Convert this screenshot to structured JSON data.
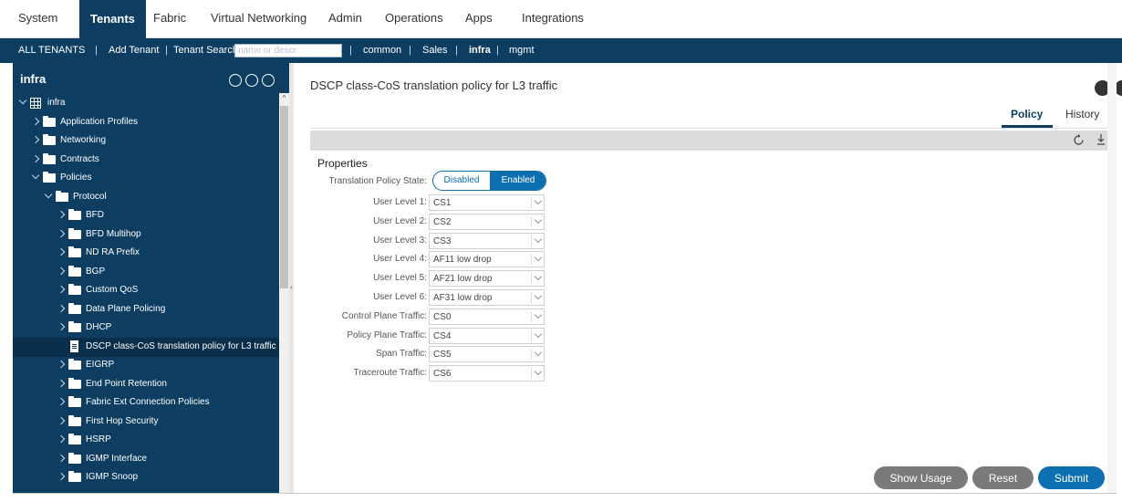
{
  "topnav": {
    "items": [
      "System",
      "Tenants",
      "Fabric",
      "Virtual Networking",
      "Admin",
      "Operations",
      "Apps",
      "Integrations"
    ],
    "active": "Tenants"
  },
  "tenantbar": {
    "all_tenants": "ALL TENANTS",
    "add_tenant": "Add Tenant",
    "search_label": "Tenant Search:",
    "search_placeholder": "name or descr",
    "tenants": [
      "common",
      "Sales",
      "infra",
      "mgmt"
    ],
    "separator": "|"
  },
  "sidebar": {
    "title": "infra",
    "tree": [
      {
        "label": "infra",
        "icon": "tenant-grid-icon",
        "chevron": "down"
      },
      {
        "label": "Application Profiles",
        "icon": "folder-icon",
        "chevron": "right"
      },
      {
        "label": "Networking",
        "icon": "folder-icon",
        "chevron": "right"
      },
      {
        "label": "Contracts",
        "icon": "folder-icon",
        "chevron": "right"
      },
      {
        "label": "Policies",
        "icon": "folder-icon",
        "chevron": "down"
      },
      {
        "label": "Protocol",
        "icon": "folder-icon",
        "chevron": "down"
      },
      {
        "label": "BFD",
        "icon": "folder-icon",
        "chevron": "right"
      },
      {
        "label": "BFD Multihop",
        "icon": "folder-icon",
        "chevron": "right"
      },
      {
        "label": "ND RA Prefix",
        "icon": "folder-icon",
        "chevron": "right"
      },
      {
        "label": "BGP",
        "icon": "folder-icon",
        "chevron": "right"
      },
      {
        "label": "Custom QoS",
        "icon": "folder-icon",
        "chevron": "right"
      },
      {
        "label": "Data Plane Policing",
        "icon": "folder-icon",
        "chevron": "right"
      },
      {
        "label": "DHCP",
        "icon": "folder-icon",
        "chevron": "right"
      },
      {
        "label": "DSCP class-CoS translation policy for L3 traffic",
        "icon": "document-icon",
        "chevron": "none",
        "selected": true
      },
      {
        "label": "EIGRP",
        "icon": "folder-icon",
        "chevron": "right"
      },
      {
        "label": "End Point Retention",
        "icon": "folder-icon",
        "chevron": "right"
      },
      {
        "label": "Fabric Ext Connection Policies",
        "icon": "folder-icon",
        "chevron": "right"
      },
      {
        "label": "First Hop Security",
        "icon": "folder-icon",
        "chevron": "right"
      },
      {
        "label": "HSRP",
        "icon": "folder-icon",
        "chevron": "right"
      },
      {
        "label": "IGMP Interface",
        "icon": "folder-icon",
        "chevron": "right"
      },
      {
        "label": "IGMP Snoop",
        "icon": "folder-icon",
        "chevron": "right"
      }
    ]
  },
  "main": {
    "title": "DSCP class-CoS translation policy for L3 traffic",
    "tabs": [
      "Policy",
      "History"
    ],
    "active_tab": "Policy",
    "section_title": "Properties",
    "toggle": {
      "label": "Translation Policy State:",
      "options": [
        "Disabled",
        "Enabled"
      ],
      "selected": "Enabled"
    },
    "fields": [
      {
        "label": "User Level 1:",
        "value": "CS1"
      },
      {
        "label": "User Level 2:",
        "value": "CS2"
      },
      {
        "label": "User Level 3:",
        "value": "CS3"
      },
      {
        "label": "User Level 4:",
        "value": "AF11 low drop"
      },
      {
        "label": "User Level 5:",
        "value": "AF21 low drop"
      },
      {
        "label": "User Level 6:",
        "value": "AF31 low drop"
      },
      {
        "label": "Control Plane Traffic:",
        "value": "CS0"
      },
      {
        "label": "Policy Plane Traffic:",
        "value": "CS4"
      },
      {
        "label": "Span Traffic:",
        "value": "CS5"
      },
      {
        "label": "Traceroute Traffic:",
        "value": "CS6"
      }
    ]
  },
  "buttons": {
    "show_usage": "Show Usage",
    "reset": "Reset",
    "submit": "Submit"
  },
  "colors": {
    "nav_dark": "#0d3e62",
    "accent_blue": "#0d6fb0",
    "button_gray": "#7a7a7a"
  }
}
